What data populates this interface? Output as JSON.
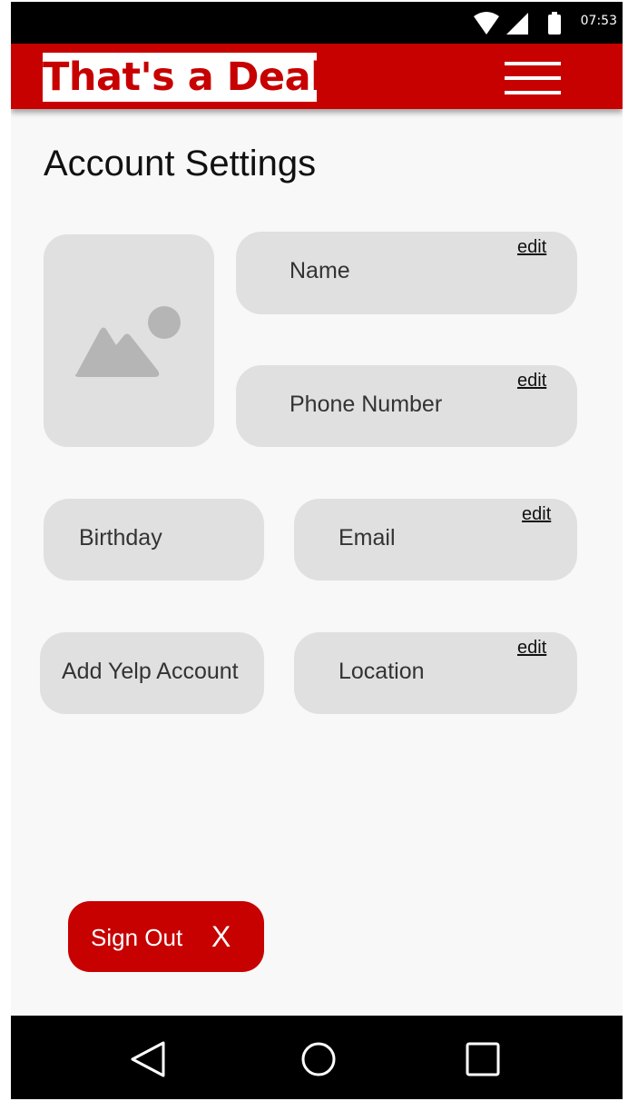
{
  "status_bar": {
    "time": "07:53",
    "icons": [
      "wifi-icon",
      "signal-icon",
      "battery-icon"
    ]
  },
  "app_bar": {
    "logo_text": "That's a Deal",
    "menu_icon": "hamburger-menu-icon",
    "brand_color": "#c70000"
  },
  "page": {
    "title": "Account Settings"
  },
  "profile": {
    "avatar_icon": "image-placeholder-icon"
  },
  "fields": {
    "name": {
      "label": "Name",
      "edit": "edit"
    },
    "phone": {
      "label": "Phone Number",
      "edit": "edit"
    },
    "birthday": {
      "label": "Birthday"
    },
    "email": {
      "label": "Email",
      "edit": "edit"
    },
    "yelp": {
      "label": "Add Yelp Account"
    },
    "location": {
      "label": "Location",
      "edit": "edit"
    }
  },
  "sign_out": {
    "label": "Sign Out",
    "close_symbol": "X"
  },
  "nav_bar": {
    "icons": [
      "back-icon",
      "home-icon",
      "recents-icon"
    ]
  }
}
